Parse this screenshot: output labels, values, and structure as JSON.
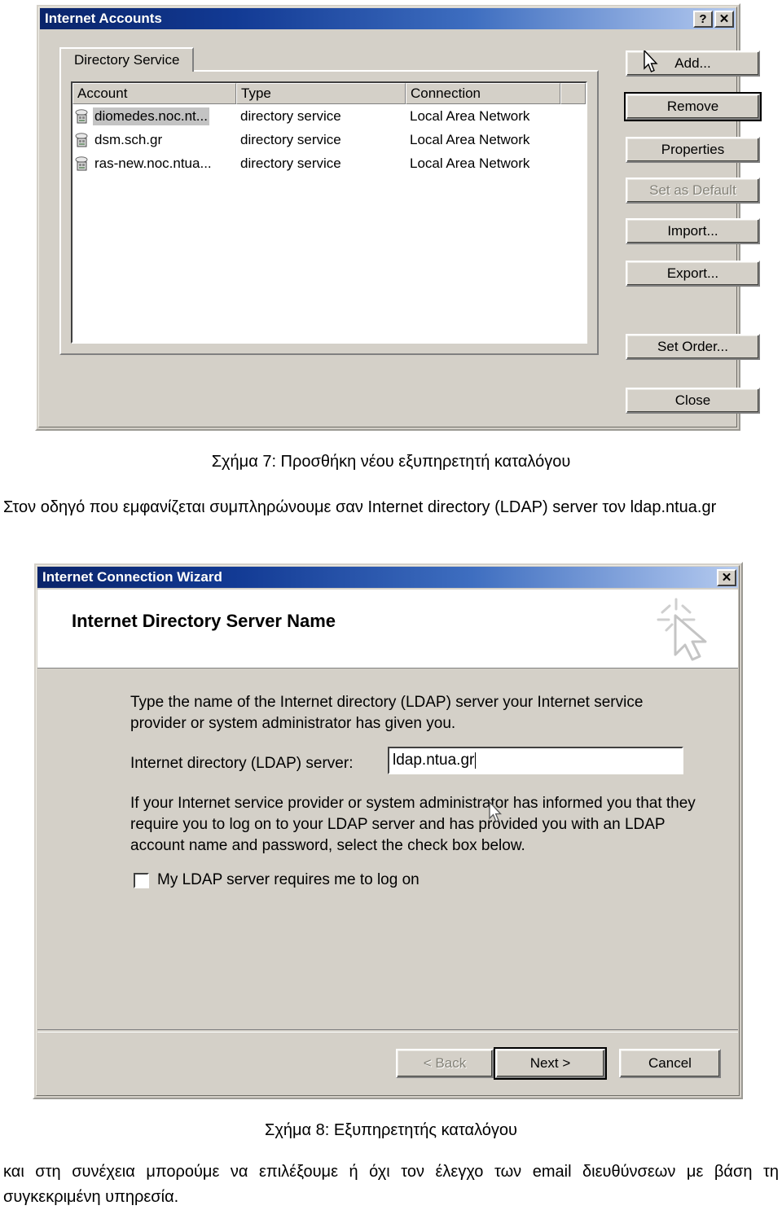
{
  "accounts_dialog": {
    "title": "Internet Accounts",
    "help_button": "?",
    "close_button": "✕",
    "tab": {
      "label": "Directory Service"
    },
    "list": {
      "columns": [
        "Account",
        "Type",
        "Connection",
        ""
      ],
      "rows": [
        {
          "icon": "directory-server-icon",
          "account": "diomedes.noc.nt...",
          "type": "directory service",
          "connection": "Local Area Network",
          "selected": true
        },
        {
          "icon": "directory-server-icon",
          "account": "dsm.sch.gr",
          "type": "directory service",
          "connection": "Local Area Network",
          "selected": false
        },
        {
          "icon": "directory-server-icon",
          "account": "ras-new.noc.ntua...",
          "type": "directory service",
          "connection": "Local Area Network",
          "selected": false
        }
      ]
    },
    "buttons": {
      "add": "Add...",
      "remove": "Remove",
      "properties": "Properties",
      "set_as_default": "Set as Default",
      "import": "Import...",
      "export": "Export...",
      "set_order": "Set Order...",
      "close": "Close"
    }
  },
  "figure7": {
    "caption": "Σχήμα 7: Προσθήκη νέου εξυπηρετητή καταλόγου"
  },
  "body_text_1": "Στον οδηγό που εμφανίζεται συμπληρώνουμε σαν Internet directory (LDAP) server τον ldap.ntua.gr",
  "wizard_dialog": {
    "title": "Internet Connection Wizard",
    "close_button": "✕",
    "banner_title": "Internet Directory Server Name",
    "banner_icon": "mouse-cursor-sparkle-icon",
    "instruction": "Type the name of the Internet directory (LDAP) server your Internet service provider or system administrator has given you.",
    "server_label": "Internet directory (LDAP) server:",
    "server_value": "ldap.ntua.gr",
    "logon_info": "If your Internet service provider or system administrator has informed you that they require you to log on to your LDAP server and has provided you with an LDAP account name and password, select the check box below.",
    "checkbox_label": "My LDAP server requires me to log on",
    "checkbox_checked": false,
    "buttons": {
      "back": "< Back",
      "next": "Next >",
      "cancel": "Cancel"
    }
  },
  "figure8": {
    "caption": "Σχήμα 8: Εξυπηρετητής καταλόγου"
  },
  "body_text_2": "και στη συνέχεια μπορούμε να επιλέξουμε ή όχι τον έλεγχο των email διευθύνσεων με βάση τη συγκεκριμένη υπηρεσία.",
  "colors": {
    "title_bar_start": "#0a246a",
    "title_bar_end": "#b6cbee",
    "dialog_face": "#d4d0c8",
    "selection": "#c3c3c3",
    "field_bg": "#ffffff",
    "disabled_text": "#848278"
  }
}
